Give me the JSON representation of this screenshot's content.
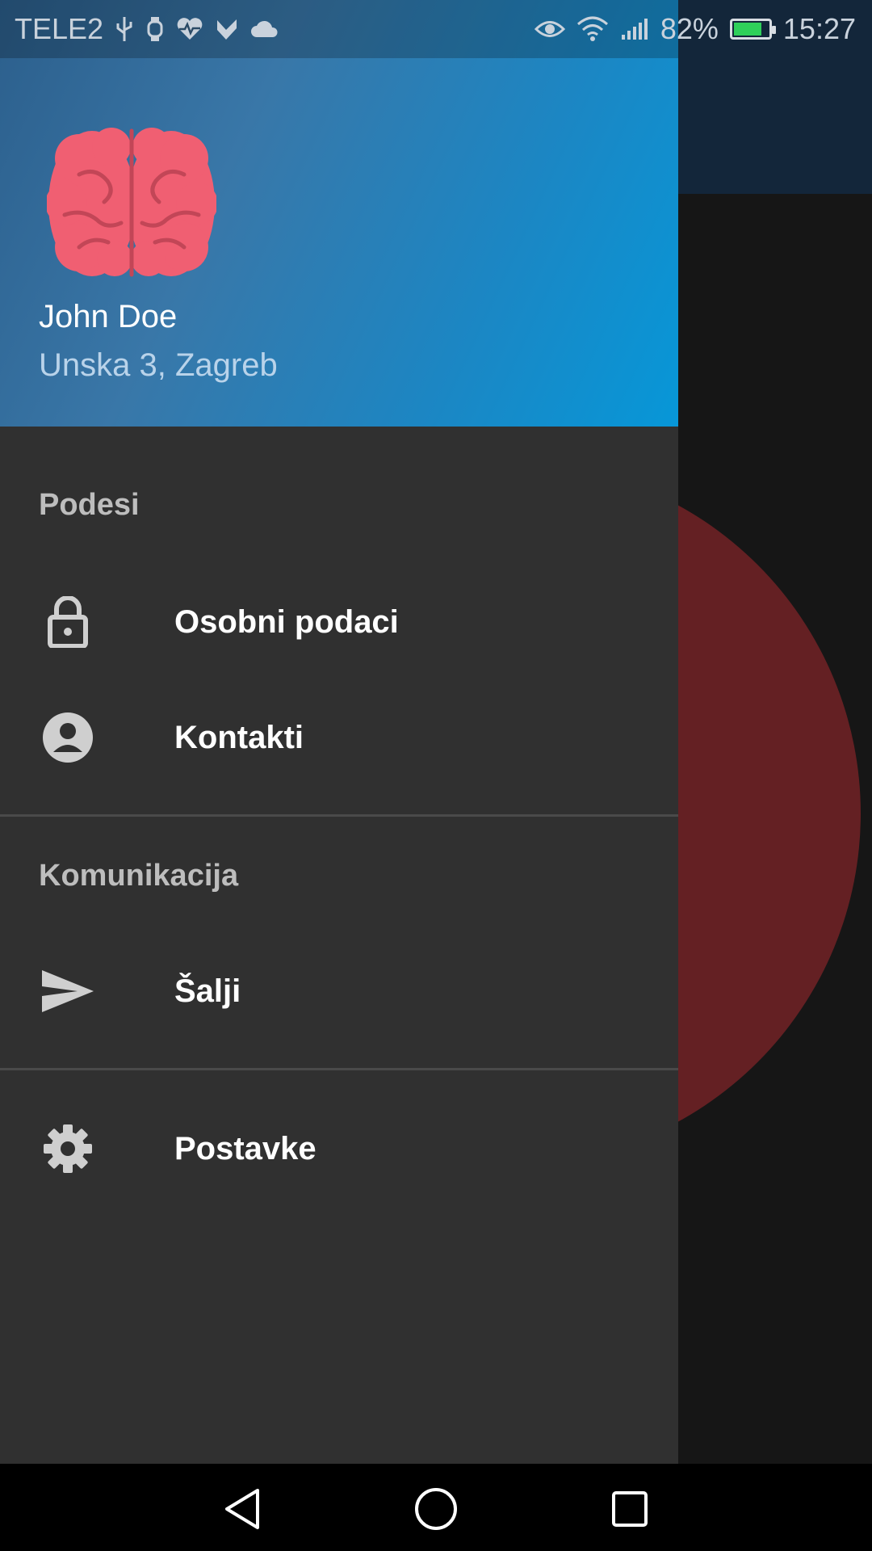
{
  "status_bar": {
    "carrier": "TELE2",
    "battery_percent": "82%",
    "battery_level": 0.82,
    "time": "15:27",
    "icons": [
      "usb-icon",
      "watch-icon",
      "heart-rate-icon",
      "tasks-icon",
      "cloud-icon",
      "eye-icon",
      "wifi-icon",
      "signal-icon",
      "battery-icon"
    ]
  },
  "drawer": {
    "header": {
      "avatar_icon": "brain-icon",
      "user_name": "John Doe",
      "user_address": "Unska 3,  Zagreb"
    },
    "sections": [
      {
        "title": "Podesi",
        "items": [
          {
            "label": "Osobni podaci",
            "icon": "lock-icon"
          },
          {
            "label": "Kontakti",
            "icon": "account-circle-icon"
          }
        ]
      },
      {
        "title": "Komunikacija",
        "items": [
          {
            "label": "Šalji",
            "icon": "send-icon"
          }
        ]
      },
      {
        "title": "",
        "items": [
          {
            "label": "Postavke",
            "icon": "gear-icon"
          }
        ]
      }
    ]
  },
  "background_app": {
    "fab_icon": "mail-icon"
  },
  "colors": {
    "drawer_bg": "#303030",
    "header_gradient_start": "#2c5f8c",
    "header_gradient_end": "#0797d8",
    "brain": "#f05f72",
    "circle": "#642023",
    "fab": "#6a4a0c"
  }
}
